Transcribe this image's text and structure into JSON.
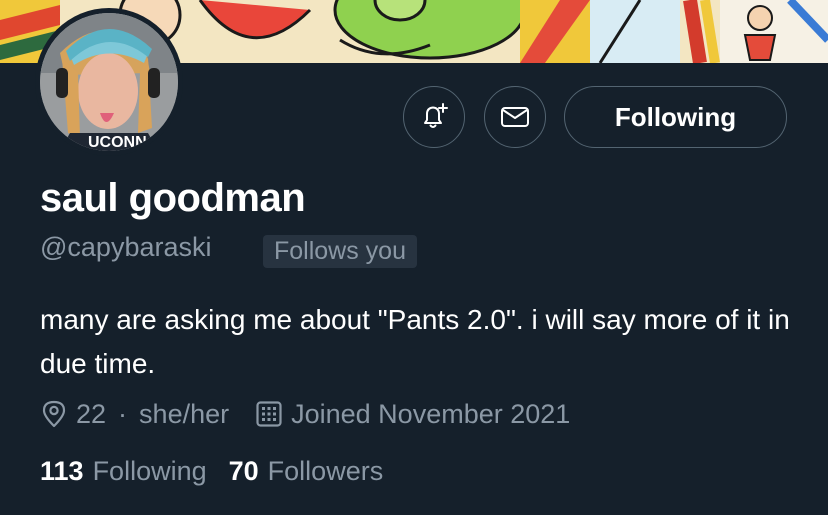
{
  "profile": {
    "name": "saul goodman",
    "handle": "@capybaraski",
    "follows_you_badge": "Follows you",
    "bio": "many are asking me about \"Pants 2.0\". i will say more of it in due time.",
    "location": "22",
    "separator": "·",
    "pronouns": "she/her",
    "joined": "Joined November 2021",
    "following_count": "113",
    "following_label": "Following",
    "followers_count": "70",
    "followers_label": "Followers",
    "avatar_shirt_text": "UCONN"
  },
  "actions": {
    "follow_button_label": "Following",
    "notify_icon": "bell-plus-icon",
    "message_icon": "envelope-icon"
  },
  "colors": {
    "background": "#15202b",
    "secondary_text": "#8b98a5",
    "border": "#536471",
    "badge_bg": "#273340"
  }
}
